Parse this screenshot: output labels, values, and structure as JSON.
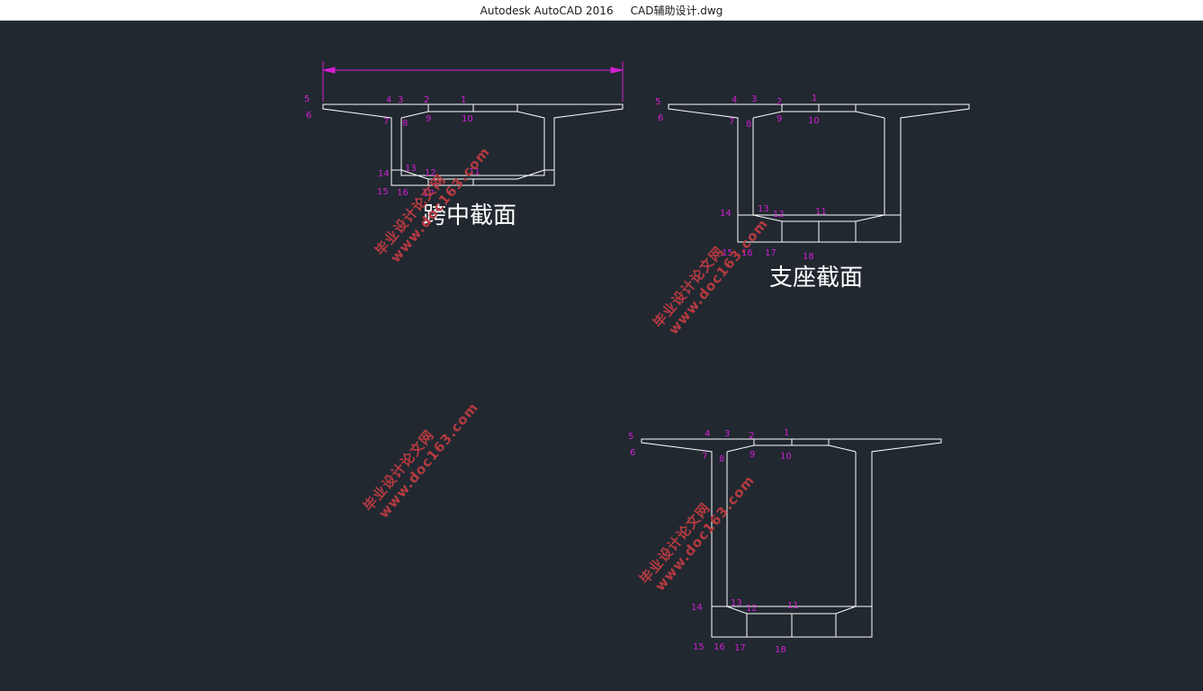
{
  "window": {
    "title": "Autodesk AutoCAD 2016     CAD辅助设计.dwg"
  },
  "drawing": {
    "captions": {
      "midspan": "跨中截面",
      "support": "支座截面"
    },
    "point_labels": [
      "1",
      "2",
      "3",
      "4",
      "5",
      "6",
      "7",
      "8",
      "9",
      "10",
      "11",
      "12",
      "13",
      "14",
      "15",
      "16",
      "17",
      "18"
    ],
    "watermark": {
      "cn": "毕业设计论文网",
      "url": "www.doc163.com"
    },
    "colors": {
      "background": "#212830",
      "linework": "#ffffff",
      "labels": "#d21fd2",
      "dimension": "#d21fd2",
      "watermark": "#b53a40"
    }
  }
}
